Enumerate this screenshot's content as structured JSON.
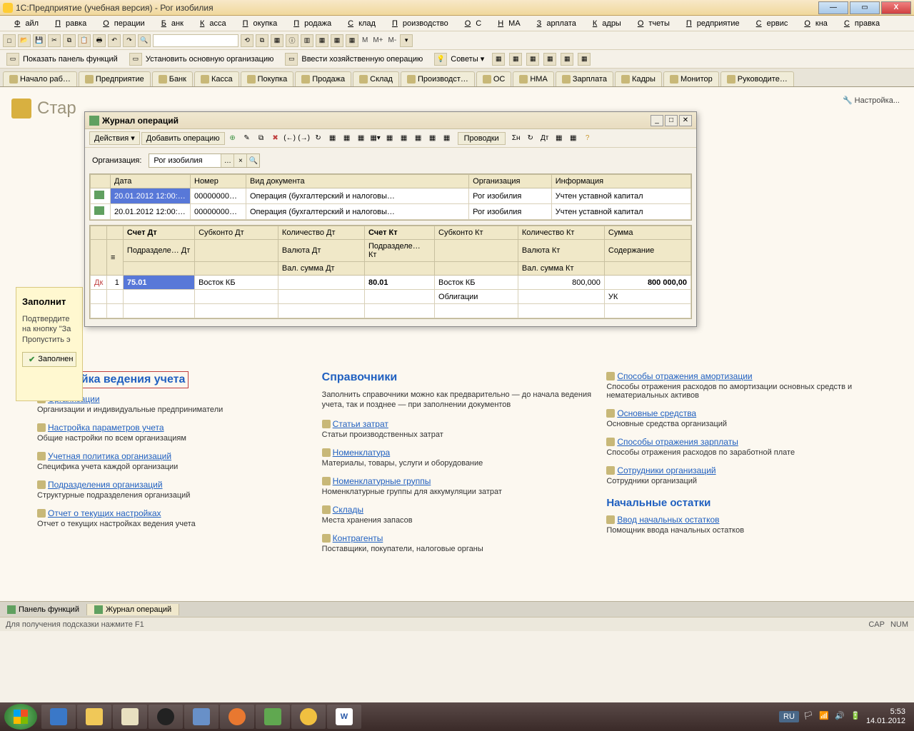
{
  "titlebar": {
    "title": "1С:Предприятие (учебная версия) - Рог изобилия"
  },
  "menubar": [
    "Файл",
    "Правка",
    "Операции",
    "Банк",
    "Касса",
    "Покупка",
    "Продажа",
    "Склад",
    "Производство",
    "ОС",
    "НМА",
    "Зарплата",
    "Кадры",
    "Отчеты",
    "Предприятие",
    "Сервис",
    "Окна",
    "Справка"
  ],
  "toolbar2": {
    "show_panel": "Показать панель функций",
    "set_org": "Установить основную организацию",
    "enter_op": "Ввести хозяйственную операцию",
    "tips": "Советы"
  },
  "tabs": [
    "Начало раб…",
    "Предприятие",
    "Банк",
    "Касса",
    "Покупка",
    "Продажа",
    "Склад",
    "Производст…",
    "ОС",
    "НМА",
    "Зарплата",
    "Кадры",
    "Монитор",
    "Руководите…"
  ],
  "page": {
    "title": "Стар",
    "settings": "Настройка...",
    "yellow": {
      "title": "Заполнит",
      "text": "Подтвердите\nна кнопку \"За\nПропустить э",
      "btn": "Заполнен"
    },
    "col1": {
      "h": "Настройка ведения учета",
      "items": [
        {
          "a": "Организации",
          "p": "Организации и индивидуальные предприниматели"
        },
        {
          "a": "Настройка параметров учета",
          "p": "Общие настройки по всем организациям"
        },
        {
          "a": "Учетная политика организаций",
          "p": "Специфика учета каждой организации"
        },
        {
          "a": "Подразделения организаций",
          "p": "Структурные подразделения организаций"
        },
        {
          "a": "Отчет о текущих настройках",
          "p": "Отчет о текущих настройках ведения учета"
        }
      ]
    },
    "col2": {
      "h": "Справочники",
      "desc": "Заполнить справочники можно как предварительно — до начала ведения учета, так и позднее — при заполнении документов",
      "items": [
        {
          "a": "Статьи затрат",
          "p": "Статьи производственных затрат"
        },
        {
          "a": "Номенклатура",
          "p": "Материалы, товары, услуги и оборудование"
        },
        {
          "a": "Номенклатурные группы",
          "p": "Номенклатурные группы для аккумуляции затрат"
        },
        {
          "a": "Склады",
          "p": "Места хранения запасов"
        },
        {
          "a": "Контрагенты",
          "p": "Поставщики, покупатели, налоговые органы"
        }
      ]
    },
    "col3": {
      "items": [
        {
          "a": "Способы отражения амортизации",
          "p": "Способы отражения расходов по амортизации основных средств и нематериальных активов"
        },
        {
          "a": "Основные средства",
          "p": "Основные средства организаций"
        },
        {
          "a": "Способы отражения зарплаты",
          "p": "Способы отражения расходов по заработной плате"
        },
        {
          "a": "Сотрудники организаций",
          "p": "Сотрудники организаций"
        }
      ],
      "h2": "Начальные остатки",
      "items2": [
        {
          "a": "Ввод начальных остатков",
          "p": "Помощник ввода начальных остатков"
        }
      ]
    }
  },
  "modal": {
    "title": "Журнал операций",
    "actions": "Действия",
    "add_op": "Добавить операцию",
    "provodki": "Проводки",
    "org_label": "Организация:",
    "org_value": "Рог изобилия",
    "grid1": {
      "headers": [
        "",
        "Дата",
        "Номер",
        "Вид документа",
        "Организация",
        "Информация"
      ],
      "rows": [
        {
          "date": "20.01.2012 12:00:…",
          "num": "00000000…",
          "type": "Операция (бухгалтерский и налоговы…",
          "org": "Рог изобилия",
          "info": "Учтен уставной капитал",
          "sel": true
        },
        {
          "date": "20.01.2012 12:00:…",
          "num": "00000000…",
          "type": "Операция (бухгалтерский и налоговы…",
          "org": "Рог изобилия",
          "info": "Учтен уставной капитал",
          "sel": false
        }
      ]
    },
    "grid2": {
      "h1": [
        "",
        "",
        "Счет Дт",
        "Субконто Дт",
        "Количество Дт",
        "Счет Кт",
        "Субконто Кт",
        "Количество Кт",
        "Сумма"
      ],
      "h2": [
        "Подразделе… Дт",
        "",
        "Валюта Дт",
        "Подразделе… Кт",
        "",
        "Валюта Кт",
        "Содержание"
      ],
      "h3": [
        "",
        "",
        "Вал. сумма Дт",
        "",
        "",
        "Вал. сумма Кт",
        ""
      ],
      "row": {
        "n": "1",
        "dt": "75.01",
        "subdt": "Восток КБ",
        "kt": "80.01",
        "subkt": "Восток КБ",
        "qtykt": "800,000",
        "sum": "800 000,00",
        "subkt2": "Облигации",
        "desc": "УК"
      }
    }
  },
  "taskwins": [
    {
      "label": "Панель функций",
      "active": false
    },
    {
      "label": "Журнал операций",
      "active": true
    }
  ],
  "statusbar": {
    "hint": "Для получения подсказки нажмите F1",
    "cap": "CAP",
    "num": "NUM"
  },
  "systray": {
    "lang": "RU",
    "time": "5:53",
    "date": "14.01.2012"
  }
}
